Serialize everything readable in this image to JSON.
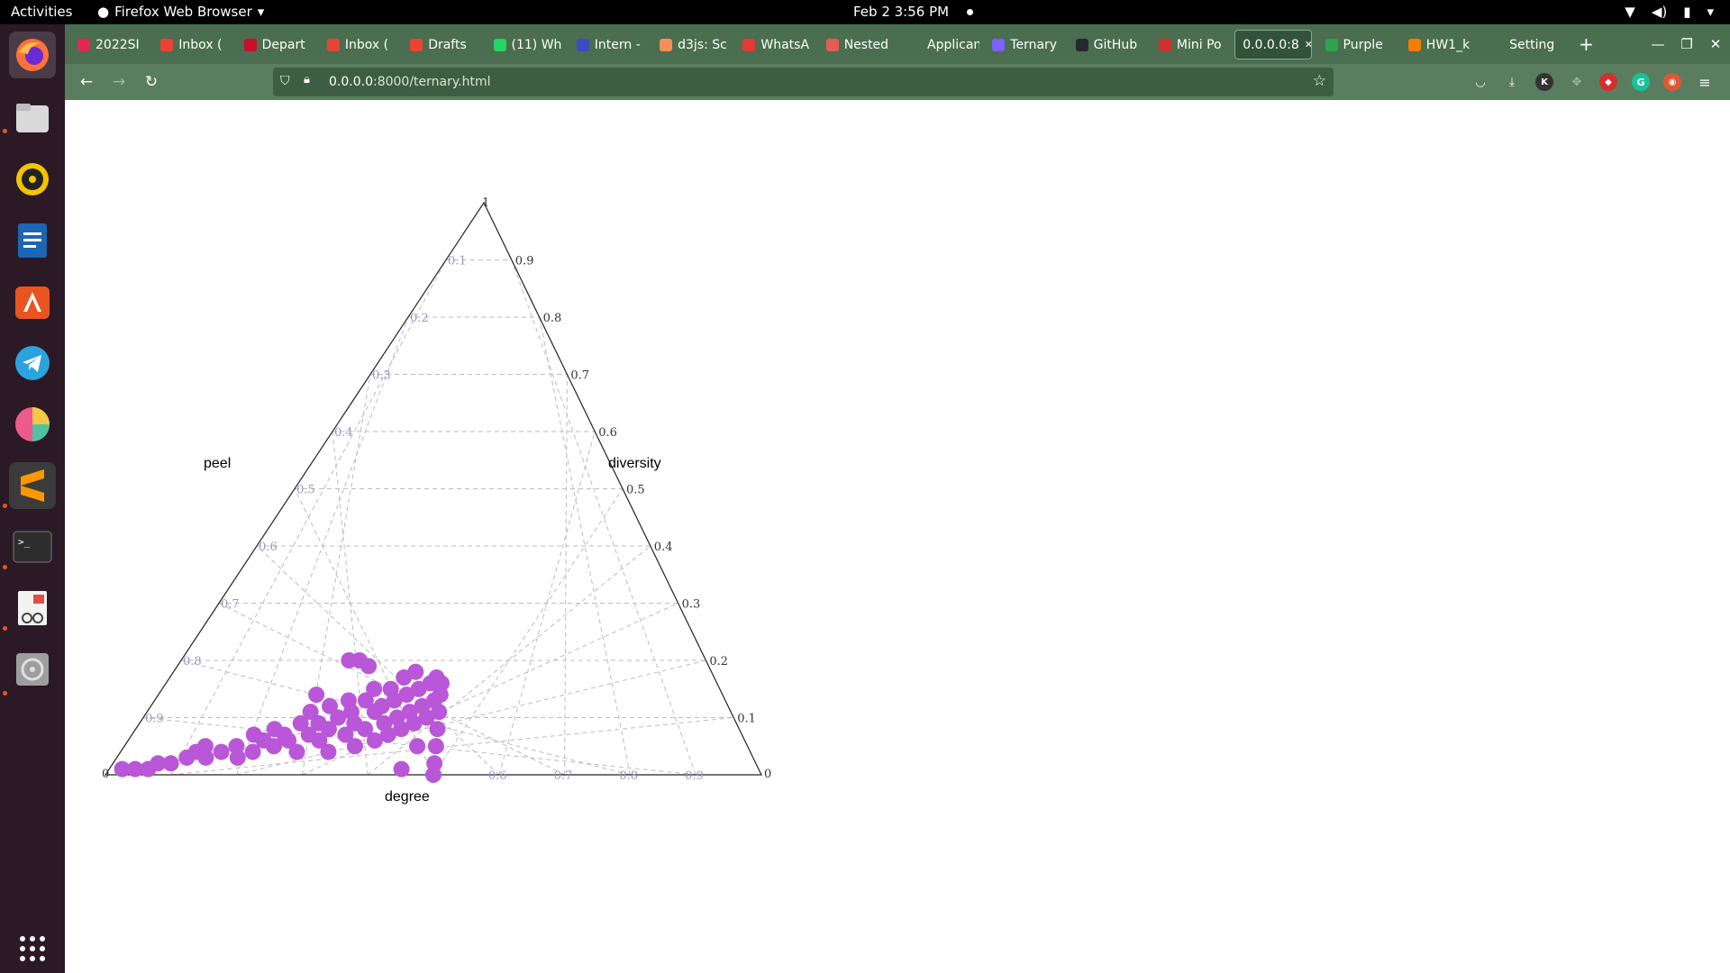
{
  "topbar": {
    "activities": "Activities",
    "app_name": "Firefox Web Browser",
    "clock": "Feb 2  3:56 PM"
  },
  "dock": {
    "items": [
      "firefox-icon",
      "files-icon",
      "rhythmbox-icon",
      "writer-icon",
      "software-icon",
      "telegram-icon",
      "color-picker-icon",
      "sublime-text-icon",
      "terminal-icon",
      "document-viewer-icon",
      "disks-icon"
    ],
    "show_apps": "show-apps-icon"
  },
  "browser": {
    "tabs": [
      {
        "label": "2022SI",
        "color": "#e22850"
      },
      {
        "label": "Inbox (",
        "color": "#ea4335"
      },
      {
        "label": "Depart",
        "color": "#c8102e"
      },
      {
        "label": "Inbox (",
        "color": "#ea4335"
      },
      {
        "label": "Drafts",
        "color": "#ea4335"
      },
      {
        "label": "(11) Wh",
        "color": "#25d366"
      },
      {
        "label": "Intern -",
        "color": "#3b4bc8"
      },
      {
        "label": "d3js: Sc",
        "color": "#f68e56"
      },
      {
        "label": "WhatsA",
        "color": "#e53935"
      },
      {
        "label": "Nested",
        "color": "#e65c4f"
      },
      {
        "label": "Applicant",
        "color": "#4a6e4f"
      },
      {
        "label": "Ternary",
        "color": "#7b61ff"
      },
      {
        "label": "GitHub",
        "color": "#24292e"
      },
      {
        "label": "Mini Po",
        "color": "#d32f2f"
      },
      {
        "label": "0.0.0.0:8",
        "color": "#33523a"
      },
      {
        "label": "Purple",
        "color": "#2fa34c"
      },
      {
        "label": "HW1_k",
        "color": "#f57c00"
      },
      {
        "label": "Setting",
        "color": "#4a6e4f"
      }
    ],
    "url_host": "0.0.0.0",
    "url_path": ":8000/ternary.html"
  },
  "colors": {
    "point": "#b957d8",
    "grid": "#bdbdbd",
    "left_tick": "#9a97c8",
    "right_tick": "#333333",
    "bottom_tick": "#9a97c8"
  },
  "chart_data": {
    "type": "scatter",
    "subtype": "ternary",
    "axes": {
      "left": {
        "label": "peel",
        "ticks": [
          "0.1",
          "0.2",
          "0.3",
          "0.4",
          "0.5",
          "0.6",
          "0.7",
          "0.8",
          "0.9"
        ]
      },
      "right": {
        "label": "diversity",
        "ticks": [
          "0.9",
          "0.8",
          "0.7",
          "0.6",
          "0.5",
          "0.4",
          "0.3",
          "0.2",
          "0.1"
        ]
      },
      "bottom": {
        "label": "degree",
        "ticks": [
          "0.6",
          "0.7",
          "0.8",
          "0.9"
        ]
      }
    },
    "corner_labels": {
      "top": "1",
      "left": "0",
      "right": "0"
    },
    "grid": true,
    "points": [
      [
        0.02,
        0.01
      ],
      [
        0.04,
        0.01
      ],
      [
        0.06,
        0.01
      ],
      [
        0.07,
        0.02
      ],
      [
        0.09,
        0.02
      ],
      [
        0.11,
        0.03
      ],
      [
        0.12,
        0.04
      ],
      [
        0.13,
        0.05
      ],
      [
        0.14,
        0.03
      ],
      [
        0.16,
        0.04
      ],
      [
        0.18,
        0.05
      ],
      [
        0.19,
        0.03
      ],
      [
        0.2,
        0.07
      ],
      [
        0.21,
        0.04
      ],
      [
        0.22,
        0.06
      ],
      [
        0.23,
        0.08
      ],
      [
        0.24,
        0.05
      ],
      [
        0.25,
        0.07
      ],
      [
        0.26,
        0.06
      ],
      [
        0.27,
        0.09
      ],
      [
        0.28,
        0.04
      ],
      [
        0.28,
        0.11
      ],
      [
        0.29,
        0.07
      ],
      [
        0.3,
        0.09
      ],
      [
        0.31,
        0.06
      ],
      [
        0.31,
        0.12
      ],
      [
        0.32,
        0.08
      ],
      [
        0.33,
        0.1
      ],
      [
        0.33,
        0.04
      ],
      [
        0.34,
        0.13
      ],
      [
        0.35,
        0.07
      ],
      [
        0.35,
        0.11
      ],
      [
        0.36,
        0.09
      ],
      [
        0.37,
        0.05
      ],
      [
        0.37,
        0.13
      ],
      [
        0.38,
        0.08
      ],
      [
        0.38,
        0.15
      ],
      [
        0.39,
        0.11
      ],
      [
        0.4,
        0.06
      ],
      [
        0.4,
        0.12
      ],
      [
        0.41,
        0.09
      ],
      [
        0.41,
        0.15
      ],
      [
        0.42,
        0.07
      ],
      [
        0.42,
        0.13
      ],
      [
        0.43,
        0.1
      ],
      [
        0.43,
        0.17
      ],
      [
        0.44,
        0.08
      ],
      [
        0.44,
        0.14
      ],
      [
        0.45,
        0.11
      ],
      [
        0.45,
        0.18
      ],
      [
        0.46,
        0.09
      ],
      [
        0.46,
        0.15
      ],
      [
        0.47,
        0.12
      ],
      [
        0.47,
        0.05
      ],
      [
        0.48,
        0.16
      ],
      [
        0.48,
        0.1
      ],
      [
        0.49,
        0.13
      ],
      [
        0.49,
        0.17
      ],
      [
        0.5,
        0.08
      ],
      [
        0.5,
        0.11
      ],
      [
        0.5,
        0.14
      ],
      [
        0.5,
        0.05
      ],
      [
        0.5,
        0.02
      ],
      [
        0.5,
        0.16
      ],
      [
        0.5,
        0.0
      ],
      [
        0.45,
        0.01
      ],
      [
        0.36,
        0.19
      ],
      [
        0.34,
        0.2
      ],
      [
        0.32,
        0.2
      ],
      [
        0.28,
        0.14
      ]
    ]
  }
}
